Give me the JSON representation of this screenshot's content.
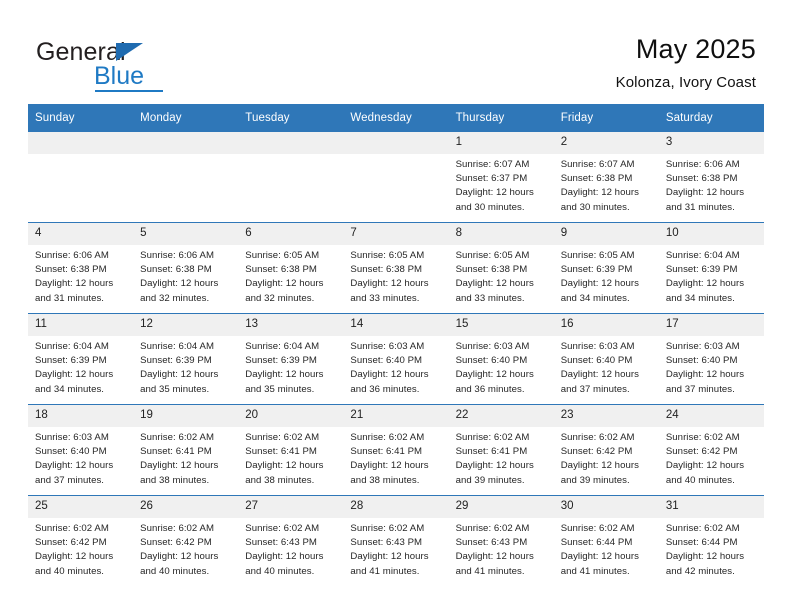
{
  "brand": {
    "name_top": "General",
    "name_bottom": "Blue",
    "accent_color": "#2f77b8",
    "logo_blue": "#1f7ac4"
  },
  "header": {
    "title": "May 2025",
    "subtitle": "Kolonza, Ivory Coast"
  },
  "calendar": {
    "weekday_headers": [
      "Sunday",
      "Monday",
      "Tuesday",
      "Wednesday",
      "Thursday",
      "Friday",
      "Saturday"
    ],
    "labels": {
      "sunrise": "Sunrise:",
      "sunset": "Sunset:",
      "daylight": "Daylight:"
    },
    "weeks": [
      [
        {
          "day": "",
          "sunrise": "",
          "sunset": "",
          "daylight": ""
        },
        {
          "day": "",
          "sunrise": "",
          "sunset": "",
          "daylight": ""
        },
        {
          "day": "",
          "sunrise": "",
          "sunset": "",
          "daylight": ""
        },
        {
          "day": "",
          "sunrise": "",
          "sunset": "",
          "daylight": ""
        },
        {
          "day": "1",
          "sunrise": "Sunrise: 6:07 AM",
          "sunset": "Sunset: 6:37 PM",
          "daylight": "Daylight: 12 hours and 30 minutes."
        },
        {
          "day": "2",
          "sunrise": "Sunrise: 6:07 AM",
          "sunset": "Sunset: 6:38 PM",
          "daylight": "Daylight: 12 hours and 30 minutes."
        },
        {
          "day": "3",
          "sunrise": "Sunrise: 6:06 AM",
          "sunset": "Sunset: 6:38 PM",
          "daylight": "Daylight: 12 hours and 31 minutes."
        }
      ],
      [
        {
          "day": "4",
          "sunrise": "Sunrise: 6:06 AM",
          "sunset": "Sunset: 6:38 PM",
          "daylight": "Daylight: 12 hours and 31 minutes."
        },
        {
          "day": "5",
          "sunrise": "Sunrise: 6:06 AM",
          "sunset": "Sunset: 6:38 PM",
          "daylight": "Daylight: 12 hours and 32 minutes."
        },
        {
          "day": "6",
          "sunrise": "Sunrise: 6:05 AM",
          "sunset": "Sunset: 6:38 PM",
          "daylight": "Daylight: 12 hours and 32 minutes."
        },
        {
          "day": "7",
          "sunrise": "Sunrise: 6:05 AM",
          "sunset": "Sunset: 6:38 PM",
          "daylight": "Daylight: 12 hours and 33 minutes."
        },
        {
          "day": "8",
          "sunrise": "Sunrise: 6:05 AM",
          "sunset": "Sunset: 6:38 PM",
          "daylight": "Daylight: 12 hours and 33 minutes."
        },
        {
          "day": "9",
          "sunrise": "Sunrise: 6:05 AM",
          "sunset": "Sunset: 6:39 PM",
          "daylight": "Daylight: 12 hours and 34 minutes."
        },
        {
          "day": "10",
          "sunrise": "Sunrise: 6:04 AM",
          "sunset": "Sunset: 6:39 PM",
          "daylight": "Daylight: 12 hours and 34 minutes."
        }
      ],
      [
        {
          "day": "11",
          "sunrise": "Sunrise: 6:04 AM",
          "sunset": "Sunset: 6:39 PM",
          "daylight": "Daylight: 12 hours and 34 minutes."
        },
        {
          "day": "12",
          "sunrise": "Sunrise: 6:04 AM",
          "sunset": "Sunset: 6:39 PM",
          "daylight": "Daylight: 12 hours and 35 minutes."
        },
        {
          "day": "13",
          "sunrise": "Sunrise: 6:04 AM",
          "sunset": "Sunset: 6:39 PM",
          "daylight": "Daylight: 12 hours and 35 minutes."
        },
        {
          "day": "14",
          "sunrise": "Sunrise: 6:03 AM",
          "sunset": "Sunset: 6:40 PM",
          "daylight": "Daylight: 12 hours and 36 minutes."
        },
        {
          "day": "15",
          "sunrise": "Sunrise: 6:03 AM",
          "sunset": "Sunset: 6:40 PM",
          "daylight": "Daylight: 12 hours and 36 minutes."
        },
        {
          "day": "16",
          "sunrise": "Sunrise: 6:03 AM",
          "sunset": "Sunset: 6:40 PM",
          "daylight": "Daylight: 12 hours and 37 minutes."
        },
        {
          "day": "17",
          "sunrise": "Sunrise: 6:03 AM",
          "sunset": "Sunset: 6:40 PM",
          "daylight": "Daylight: 12 hours and 37 minutes."
        }
      ],
      [
        {
          "day": "18",
          "sunrise": "Sunrise: 6:03 AM",
          "sunset": "Sunset: 6:40 PM",
          "daylight": "Daylight: 12 hours and 37 minutes."
        },
        {
          "day": "19",
          "sunrise": "Sunrise: 6:02 AM",
          "sunset": "Sunset: 6:41 PM",
          "daylight": "Daylight: 12 hours and 38 minutes."
        },
        {
          "day": "20",
          "sunrise": "Sunrise: 6:02 AM",
          "sunset": "Sunset: 6:41 PM",
          "daylight": "Daylight: 12 hours and 38 minutes."
        },
        {
          "day": "21",
          "sunrise": "Sunrise: 6:02 AM",
          "sunset": "Sunset: 6:41 PM",
          "daylight": "Daylight: 12 hours and 38 minutes."
        },
        {
          "day": "22",
          "sunrise": "Sunrise: 6:02 AM",
          "sunset": "Sunset: 6:41 PM",
          "daylight": "Daylight: 12 hours and 39 minutes."
        },
        {
          "day": "23",
          "sunrise": "Sunrise: 6:02 AM",
          "sunset": "Sunset: 6:42 PM",
          "daylight": "Daylight: 12 hours and 39 minutes."
        },
        {
          "day": "24",
          "sunrise": "Sunrise: 6:02 AM",
          "sunset": "Sunset: 6:42 PM",
          "daylight": "Daylight: 12 hours and 40 minutes."
        }
      ],
      [
        {
          "day": "25",
          "sunrise": "Sunrise: 6:02 AM",
          "sunset": "Sunset: 6:42 PM",
          "daylight": "Daylight: 12 hours and 40 minutes."
        },
        {
          "day": "26",
          "sunrise": "Sunrise: 6:02 AM",
          "sunset": "Sunset: 6:42 PM",
          "daylight": "Daylight: 12 hours and 40 minutes."
        },
        {
          "day": "27",
          "sunrise": "Sunrise: 6:02 AM",
          "sunset": "Sunset: 6:43 PM",
          "daylight": "Daylight: 12 hours and 40 minutes."
        },
        {
          "day": "28",
          "sunrise": "Sunrise: 6:02 AM",
          "sunset": "Sunset: 6:43 PM",
          "daylight": "Daylight: 12 hours and 41 minutes."
        },
        {
          "day": "29",
          "sunrise": "Sunrise: 6:02 AM",
          "sunset": "Sunset: 6:43 PM",
          "daylight": "Daylight: 12 hours and 41 minutes."
        },
        {
          "day": "30",
          "sunrise": "Sunrise: 6:02 AM",
          "sunset": "Sunset: 6:44 PM",
          "daylight": "Daylight: 12 hours and 41 minutes."
        },
        {
          "day": "31",
          "sunrise": "Sunrise: 6:02 AM",
          "sunset": "Sunset: 6:44 PM",
          "daylight": "Daylight: 12 hours and 42 minutes."
        }
      ]
    ]
  }
}
